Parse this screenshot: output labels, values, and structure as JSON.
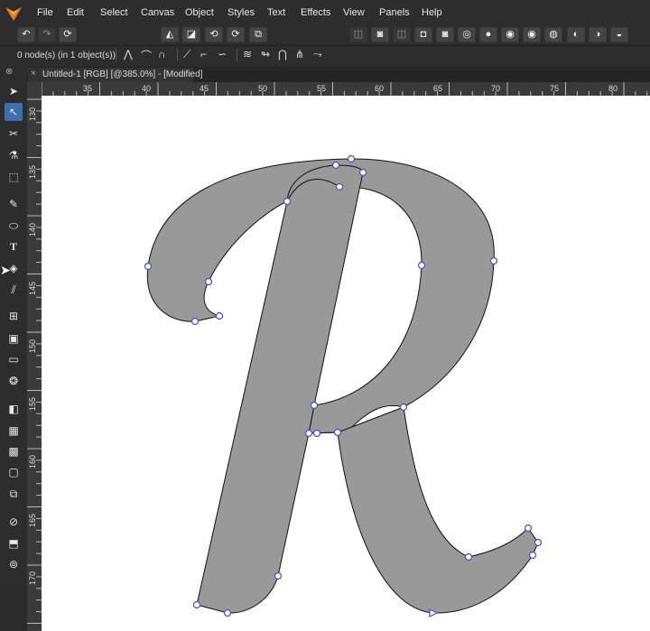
{
  "menu": [
    "File",
    "Edit",
    "Select",
    "Canvas",
    "Object",
    "Styles",
    "Text",
    "Effects",
    "View",
    "Panels",
    "Help"
  ],
  "context": {
    "status_text": "0 node(s) (in 1 object(s))"
  },
  "document_tab": {
    "title": "Untitled-1 [RGB] [@385.0%] - [Modified]"
  },
  "hruler_labels": [
    "35",
    "40",
    "45",
    "50",
    "55",
    "60",
    "65",
    "70",
    "75",
    "80"
  ],
  "vruler_labels": [
    "130",
    "135",
    "140",
    "145",
    "150",
    "155",
    "160",
    "165",
    "170"
  ],
  "tools": [
    {
      "icon": "pointer-icon"
    },
    {
      "icon": "node-tool-icon"
    },
    {
      "icon": "scissors-icon"
    },
    {
      "icon": "fill-bucket-icon"
    },
    {
      "icon": "marquee-select-icon"
    },
    {
      "icon": "pen-icon"
    },
    {
      "icon": "ellipse-icon"
    },
    {
      "icon": "text-icon"
    },
    {
      "icon": "shapes-icon"
    },
    {
      "icon": "brush-icon"
    },
    {
      "icon": "vector-brush-icon"
    },
    {
      "icon": "transparency-icon"
    },
    {
      "icon": "crop-icon"
    },
    {
      "icon": "warp-icon"
    },
    {
      "icon": "gradient-icon"
    },
    {
      "icon": "mesh-icon"
    },
    {
      "icon": "pattern-icon"
    },
    {
      "icon": "frame-icon"
    },
    {
      "icon": "copy-icon"
    },
    {
      "icon": "zoom-icon"
    },
    {
      "icon": "export-icon"
    },
    {
      "icon": "link-icon"
    }
  ],
  "colors": {
    "glyph_fill": "#999999",
    "node_stroke": "#4a4acc",
    "accent": "#3d6eb0"
  }
}
